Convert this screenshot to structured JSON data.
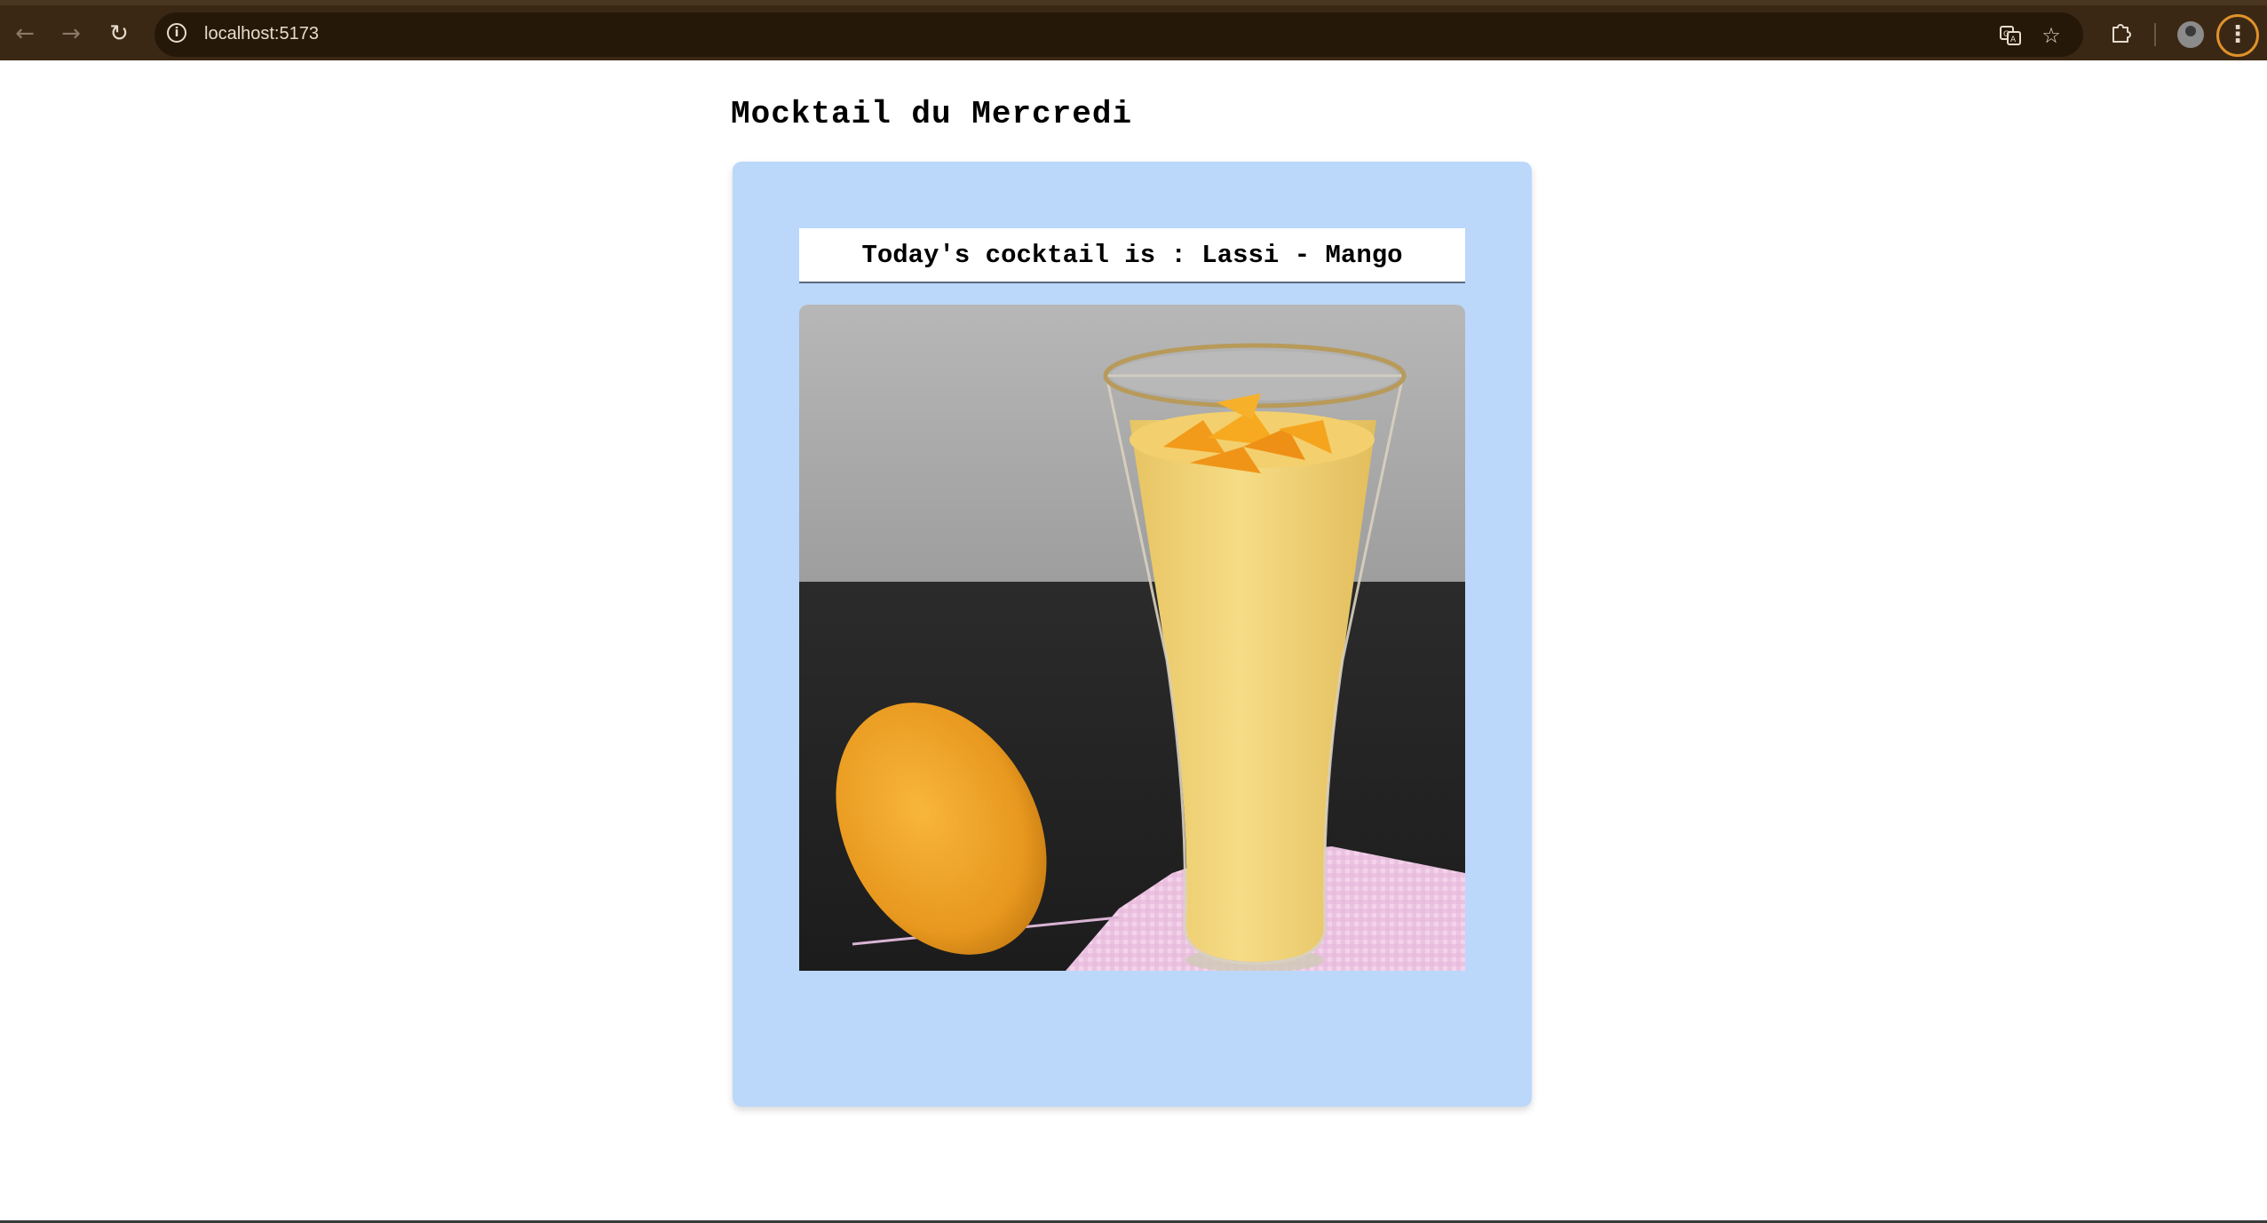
{
  "browser": {
    "url": "localhost:5173",
    "icons": {
      "back": "arrow-left-icon",
      "forward": "arrow-right-icon",
      "reload": "reload-icon",
      "site_info": "info-icon",
      "translate": "translate-icon",
      "bookmark": "star-icon",
      "extensions": "puzzle-icon",
      "profile": "avatar",
      "menu": "kebab-menu-icon"
    },
    "colors": {
      "chrome_bg": "#3b2814",
      "address_bg": "#251809",
      "menu_ring": "#e0922a"
    }
  },
  "page": {
    "title": "Mocktail du Mercredi",
    "card": {
      "heading": "Today's cocktail is : Lassi - Mango",
      "image_alt": "",
      "background": "#bbd8fb"
    }
  }
}
